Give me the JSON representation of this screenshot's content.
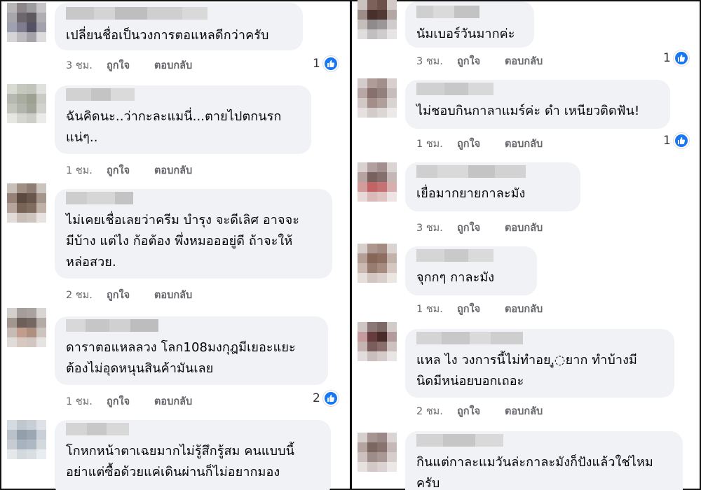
{
  "left": {
    "comments": [
      {
        "text": "เปลี่ยนชื่อเป็นวงการตอแหลดีกว่าครับ",
        "time": "3 ชม.",
        "like": "ถูกใจ",
        "reply": "ตอบกลับ",
        "reactions": "1"
      },
      {
        "text": "ฉันคิดนะ..ว่ากะละแมนี่...ตายไปตกนรก\nแน่ๆ..",
        "time": "1 ชม.",
        "like": "ถูกใจ",
        "reply": "ตอบกลับ",
        "reactions": ""
      },
      {
        "text": "ไม่เคยเชื่อเลยว่าครีม บำรุง จะดีเลิศ อาจจะ\nมีบ้าง แต่ไง ก้อต้อง พึ่งหมอออยู่ดี ถ้าจะให้\nหล่อสวย.",
        "time": "2 ชม.",
        "like": "ถูกใจ",
        "reply": "ตอบกลับ",
        "reactions": ""
      },
      {
        "text": "ดาราตอแหลลวง โลก108มงกุฎมีเยอะแยะ\nต้องไม่อุดหนุนสินค้ามันเลย",
        "time": "1 ชม.",
        "like": "ถูกใจ",
        "reply": "ตอบกลับ",
        "reactions": "2"
      },
      {
        "text": "โกหกหน้าตาเฉยมากไม่รู้สึกรู้สม คนแบบนี้\nอย่าแต่ซื้อด้วยแค่เดินผ่านก็ไม่อยากมอง",
        "time": "",
        "like": "",
        "reply": "",
        "reactions": ""
      }
    ]
  },
  "right": {
    "comments": [
      {
        "text": "นัมเบอร์วันมากค่ะ",
        "time": "3 ชม.",
        "like": "ถูกใจ",
        "reply": "ตอบกลับ",
        "reactions": "1"
      },
      {
        "text": "ไม่ชอบกินกาลาแมร์ค่ะ ดำ เหนียวติดฟัน!",
        "time": "1 ชม.",
        "like": "ถูกใจ",
        "reply": "ตอบกลับ",
        "reactions": "1"
      },
      {
        "text": "เยื่อมากยายกาละมัง",
        "time": "3 ชม.",
        "like": "ถูกใจ",
        "reply": "ตอบกลับ",
        "reactions": ""
      },
      {
        "text": "จุกกๆ กาละมัง",
        "time": "1 ชม.",
        "like": "ถูกใจ",
        "reply": "ตอบกลับ",
        "reactions": ""
      },
      {
        "text": "แหล ไง วงการนี้ไม่ทำอย,ู◌ยาก ทำบ้างมี\nนิดมีหน่อยบอกเถอะ",
        "time": "2 ชม.",
        "like": "ถูกใจ",
        "reply": "ตอบกลับ",
        "reactions": ""
      },
      {
        "text": "กินแต่กาละแมวันล่ะกาละมังก็ปังแล้วใช่ไหม\nครับ",
        "time": "",
        "like": "",
        "reply": "",
        "reactions": ""
      }
    ]
  },
  "colors": {
    "bubble": "#f0f2f5",
    "meta": "#65676b",
    "like_badge": "#1877f2"
  },
  "icons": {
    "reaction": "thumbs-up-icon"
  }
}
